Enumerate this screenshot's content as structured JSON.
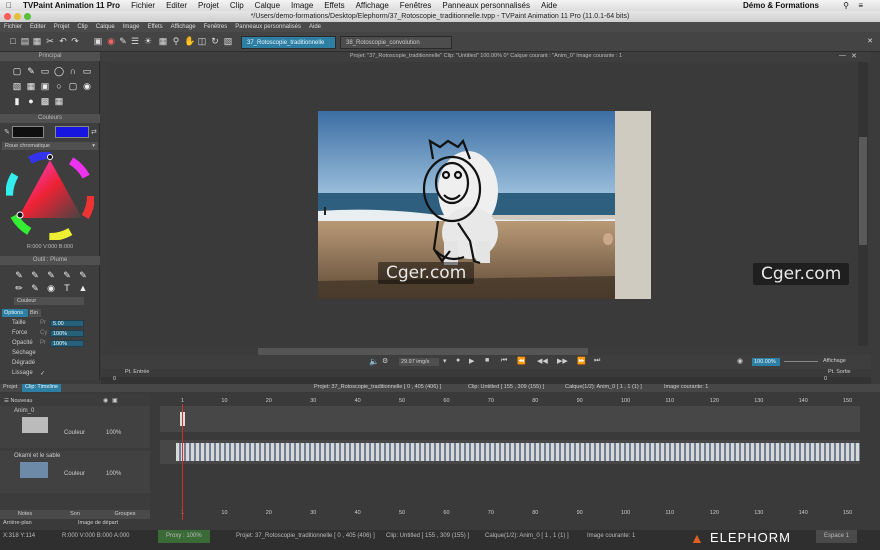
{
  "mac_menu": {
    "app": "TVPaint Animation 11 Pro",
    "items": [
      "Fichier",
      "Editer",
      "Projet",
      "Clip",
      "Calque",
      "Image",
      "Effets",
      "Affichage",
      "Fenêtres",
      "Panneaux personnalisés",
      "Aide"
    ],
    "status_title": "Démo & Formations"
  },
  "window_title": "*/Users/demo-formations/Desktop/Elephorm/37_Rotoscopie_traditionnelle.tvpp - TVPaint Animation 11 Pro (11.0.1-64 bits)",
  "app_menu": [
    "Fichier",
    "Editer",
    "Projet",
    "Clip",
    "Calque",
    "Image",
    "Effets",
    "Affichage",
    "Fenêtres",
    "Panneaux personnalisés",
    "Aide"
  ],
  "tabs": [
    {
      "label": "37_Rotoscopie_traditionnelle",
      "active": true
    },
    {
      "label": "38_Rotoscopie_convolution",
      "active": false
    }
  ],
  "panels": {
    "principal": "Principal",
    "couleurs": "Couleurs",
    "color_mode": "Roue chromatique",
    "rgb_readout": "R:000 V:000 B:000",
    "outil": "Outil : Plume",
    "couleur_label": "Couleur",
    "options_tab": "Options",
    "bin_tab": "Bin",
    "props": [
      {
        "label": "Taille",
        "prefix": "Pr",
        "value": "5.00"
      },
      {
        "label": "Force",
        "prefix": "Cy",
        "value": "100%"
      },
      {
        "label": "Opacité",
        "prefix": "Pr",
        "value": "100%"
      },
      {
        "label": "Séchage",
        "prefix": "",
        "value": ""
      },
      {
        "label": "Dégradé",
        "prefix": "",
        "value": ""
      },
      {
        "label": "Lissage",
        "prefix": "",
        "value": "✓"
      }
    ]
  },
  "canvas_info": "Projet: \"37_Rotoscopie_traditionnelle\"   Clip: \"Untitled\"   100.00%   0°   Calque courant : \"Anim_0\"   Image courante : 1",
  "colors": {
    "fg": "#0f0f0f",
    "bg": "#1616e0",
    "accent": "#2d7fa3"
  },
  "playback": {
    "fps": "29.97 img/s",
    "zoom": "100.00%",
    "affichage": "Affichage",
    "pt_entree": "Pt. Entrée",
    "pt_sortie": "Pt. Sortie",
    "start": "0",
    "end": "0"
  },
  "timeline": {
    "project_tab": "Projet",
    "clip_tab": "Clip: Timeline",
    "info_project": "Projet: 37_Rotoscopie_traditionnelle [ 0 , 405 (406) ]",
    "info_clip": "Clip: Untitled [ 155 , 309 (155) ]",
    "info_layer": "Calque(1/2): Anim_0 [ 1 , 1 (1) ]",
    "info_image": "Image courante: 1",
    "nouveau": "Nouveau",
    "layers": [
      {
        "name": "Anim_0",
        "mode": "Couleur",
        "opacity": "100%"
      },
      {
        "name": "Okami et le sable",
        "mode": "Couleur",
        "opacity": "100%"
      }
    ],
    "ruler": [
      "1",
      "10",
      "20",
      "30",
      "40",
      "50",
      "60",
      "70",
      "80",
      "90",
      "100",
      "110",
      "120",
      "130",
      "140",
      "150"
    ]
  },
  "bottom_tabs": [
    "Notes",
    "Son",
    "Groupes"
  ],
  "arriere_plan": "Arrière-plan",
  "image_depart": "Image de départ",
  "status": {
    "coords": "X:318 Y:114",
    "rgba": "R:000 V:000 B:000 A:000",
    "proxy": "Proxy : 100%",
    "project": "Projet: 37_Rotoscopie_traditionnelle [ 0 , 405 (406) ]",
    "clip": "Clip: Untitled [ 155 , 309 (155) ]",
    "layer": "Calque(1/2): Anim_0 [ 1 , 1 (1) ]",
    "image": "Image courante: 1",
    "space": "Espace 1"
  },
  "watermarks": [
    "Cger.com",
    "Cger.com"
  ],
  "brand": "ELEPHORM"
}
